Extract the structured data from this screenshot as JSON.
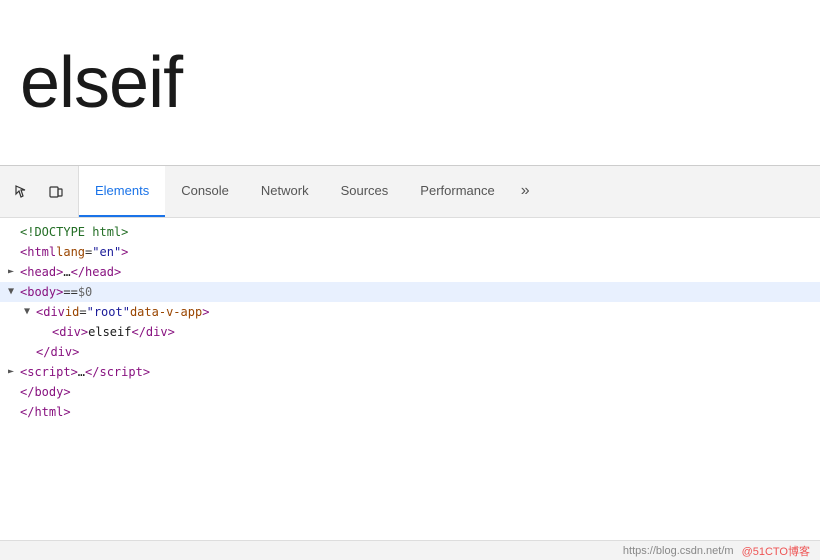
{
  "page": {
    "title": "elseif"
  },
  "devtools": {
    "tabs": [
      {
        "id": "elements",
        "label": "Elements",
        "active": true
      },
      {
        "id": "console",
        "label": "Console",
        "active": false
      },
      {
        "id": "network",
        "label": "Network",
        "active": false
      },
      {
        "id": "sources",
        "label": "Sources",
        "active": false
      },
      {
        "id": "performance",
        "label": "Performance",
        "active": false
      },
      {
        "id": "more",
        "label": "»",
        "active": false
      }
    ],
    "code_lines": [
      {
        "id": 1,
        "indent": 0,
        "arrow": "",
        "content_html": "<span class='c-meta'>&lt;!DOCTYPE html&gt;</span>",
        "highlighted": false
      },
      {
        "id": 2,
        "indent": 0,
        "arrow": "",
        "content_html": "<span class='c-tag'>&lt;html</span> <span class='c-attr'>lang</span><span class='c-eq'>=</span><span class='c-val'>\"en\"</span><span class='c-tag'>&gt;</span>",
        "highlighted": false
      },
      {
        "id": 3,
        "indent": 0,
        "arrow": "►",
        "content_html": "<span class='c-tag'>&lt;head&gt;</span><span class='c-text'>…</span><span class='c-tag'>&lt;/head&gt;</span>",
        "highlighted": false
      },
      {
        "id": 4,
        "indent": 0,
        "arrow": "▼",
        "content_html": "<span class='c-tag'>&lt;body&gt;</span> <span class='c-eq'>==</span> <span class='c-dollar'>$0</span>",
        "highlighted": true
      },
      {
        "id": 5,
        "indent": 1,
        "arrow": "▼",
        "content_html": "<span class='c-tag'>&lt;div</span> <span class='c-attr'>id</span><span class='c-eq'>=</span><span class='c-val'>\"root\"</span> <span class='c-attr'>data-v-app</span><span class='c-tag'>&gt;</span>",
        "highlighted": false
      },
      {
        "id": 6,
        "indent": 2,
        "arrow": "",
        "content_html": "<span class='c-tag'>&lt;div&gt;</span><span class='c-text'>elseif</span><span class='c-tag'>&lt;/div&gt;</span>",
        "highlighted": false
      },
      {
        "id": 7,
        "indent": 1,
        "arrow": "",
        "content_html": "<span class='c-tag'>&lt;/div&gt;</span>",
        "highlighted": false
      },
      {
        "id": 8,
        "indent": 0,
        "arrow": "►",
        "content_html": "<span class='c-tag'>&lt;script&gt;</span><span class='c-text'>…</span><span class='c-tag'>&lt;/script&gt;</span>",
        "highlighted": false
      },
      {
        "id": 9,
        "indent": 0,
        "arrow": "",
        "content_html": "<span class='c-tag'>&lt;/body&gt;</span>",
        "highlighted": false
      },
      {
        "id": 10,
        "indent": 0,
        "arrow": "",
        "content_html": "<span class='c-tag'>&lt;/html&gt;</span>",
        "highlighted": false
      }
    ]
  },
  "status_bar": {
    "url": "https://blog.csdn.net/m",
    "badge": "@51CTO博客"
  }
}
